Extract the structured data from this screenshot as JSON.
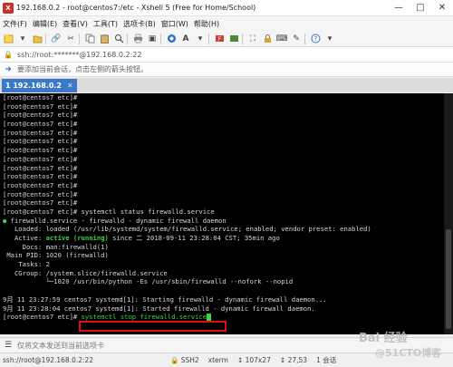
{
  "window": {
    "title": "192.168.0.2 - root@centos7:/etc - Xshell 5 (Free for Home/School)",
    "controls": [
      "—",
      "□",
      "✕"
    ]
  },
  "menu": [
    "文件(F)",
    "编辑(E)",
    "查看(V)",
    "工具(T)",
    "选项卡(B)",
    "窗口(W)",
    "帮助(H)"
  ],
  "address": {
    "text": "ssh://root:*******@192.168.0.2:22"
  },
  "hint": {
    "text": "要添加当前会话，点击左侧的箭头按钮。"
  },
  "tabs": [
    {
      "label": "1 192.168.0.2",
      "active": true
    }
  ],
  "terminal": {
    "prompt_lines": [
      "[root@centos7 etc]#",
      "[root@centos7 etc]#",
      "[root@centos7 etc]#",
      "[root@centos7 etc]#",
      "[root@centos7 etc]#",
      "[root@centos7 etc]#",
      "[root@centos7 etc]#",
      "[root@centos7 etc]#",
      "[root@centos7 etc]#",
      "[root@centos7 etc]#",
      "[root@centos7 etc]#",
      "[root@centos7 etc]#",
      "[root@centos7 etc]#"
    ],
    "status_command": "[root@centos7 etc]# systemctl status firewalld.service",
    "service_line": "firewalld.service - firewalld - dynamic firewall daemon",
    "loaded_line": "   Loaded: loaded (/usr/lib/systemd/system/firewalld.service; enabled; vendor preset: enabled)",
    "active_prefix": "   Active: ",
    "active_state": "active (running)",
    "active_suffix": " since 二 2018-09-11 23:28:04 CST; 35min ago",
    "docs_line": "     Docs: man:firewalld(1)",
    "pid_line": " Main PID: 1020 (firewalld)",
    "tasks_line": "    Tasks: 2",
    "cgroup_line": "   CGroup: /system.slice/firewalld.service",
    "cgroup_child": "           └─1020 /usr/bin/python -Es /usr/sbin/firewalld --nofork --nopid",
    "log1": "9月 11 23:27:59 centos7 systemd[1]: Starting firewalld - dynamic firewall daemon...",
    "log2": "9月 11 23:28:04 centos7 systemd[1]: Started firewalld - dynamic firewall daemon.",
    "final_prompt": "[root@centos7 etc]# ",
    "typed_command": "systemctl stop firewalld.service"
  },
  "sendbar": {
    "text": "仅将文本发送到当前选项卡"
  },
  "status": {
    "connection": "ssh://root@192.168.0.2:22",
    "protocol": "SSH2",
    "terminal_type": "xterm",
    "size": "107x27",
    "cursor_pos": "27,53",
    "sessions": "1 会话"
  },
  "watermark": {
    "line1": "Bai 经验",
    "line2": "@51CTO博客"
  }
}
